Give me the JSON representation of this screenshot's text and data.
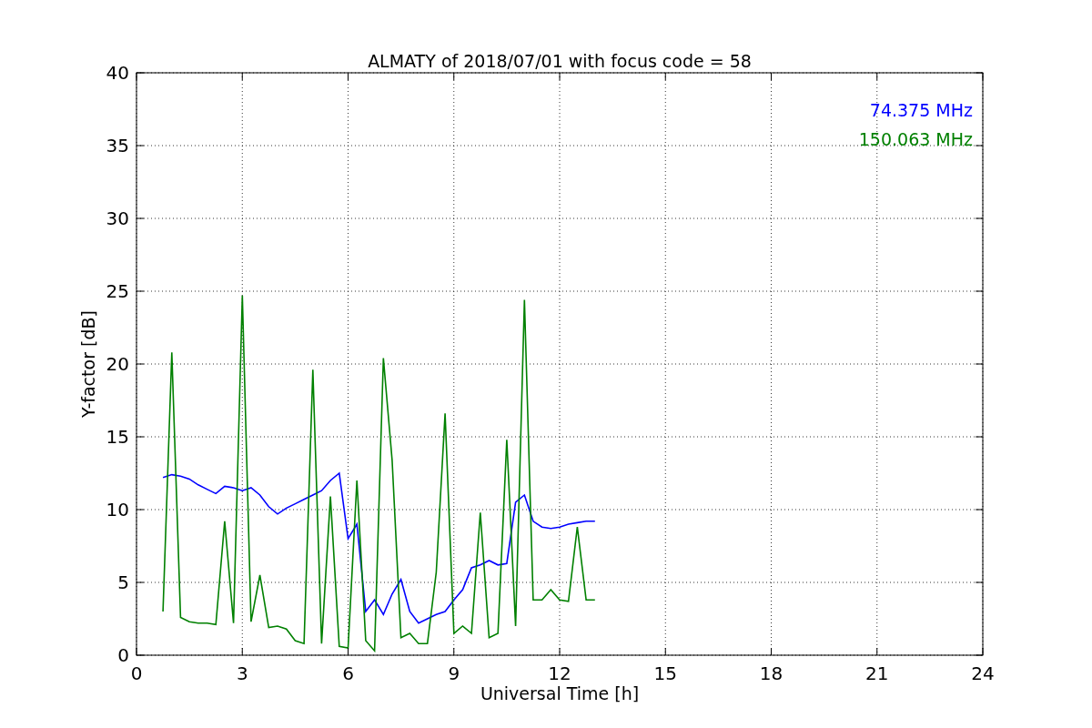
{
  "figure": {
    "chart_data": {
      "type": "line",
      "title": "ALMATY of 2018/07/01 with focus code = 58",
      "xlabel": "Universal Time [h]",
      "ylabel": "Y-factor [dB]",
      "xlim": [
        0,
        24
      ],
      "ylim": [
        0,
        40
      ],
      "xticks": [
        0,
        3,
        6,
        9,
        12,
        15,
        18,
        21,
        24
      ],
      "yticks": [
        0,
        5,
        10,
        15,
        20,
        25,
        30,
        35,
        40
      ],
      "grid": true,
      "x": [
        0.75,
        1,
        1.25,
        1.5,
        1.75,
        2,
        2.25,
        2.5,
        2.75,
        3,
        3.25,
        3.5,
        3.75,
        4,
        4.25,
        4.5,
        4.75,
        5,
        5.25,
        5.5,
        5.75,
        6,
        6.25,
        6.5,
        6.75,
        7,
        7.25,
        7.5,
        7.75,
        8,
        8.25,
        8.5,
        8.75,
        9,
        9.25,
        9.5,
        9.75,
        10,
        10.25,
        10.5,
        10.75,
        11,
        11.25,
        11.5,
        11.75,
        12,
        12.25,
        12.5,
        12.75,
        13
      ],
      "series": [
        {
          "name": "74.375 MHz",
          "color": "#0000ff",
          "values": [
            12.2,
            12.4,
            12.3,
            12.1,
            11.7,
            11.4,
            11.1,
            11.6,
            11.5,
            11.3,
            11.5,
            11.0,
            10.2,
            9.7,
            10.1,
            10.4,
            10.7,
            11.0,
            11.3,
            12.0,
            12.5,
            8.0,
            9.0,
            3.0,
            3.8,
            2.8,
            4.2,
            5.2,
            3.0,
            2.2,
            2.5,
            2.8,
            3.0,
            3.8,
            4.5,
            6.0,
            6.2,
            6.5,
            6.2,
            6.3,
            10.5,
            11.0,
            9.2,
            8.8,
            8.7,
            8.8,
            9.0,
            9.1,
            9.2,
            9.2
          ]
        },
        {
          "name": "150.063 MHz",
          "color": "#008000",
          "values": [
            3.0,
            20.8,
            2.6,
            2.3,
            2.2,
            2.2,
            2.1,
            9.2,
            2.2,
            24.7,
            2.3,
            5.5,
            1.9,
            2.0,
            1.8,
            1.0,
            0.8,
            19.6,
            0.8,
            10.9,
            0.6,
            0.5,
            12.0,
            1.0,
            0.3,
            20.4,
            13.4,
            1.2,
            1.5,
            0.8,
            0.8,
            5.7,
            16.6,
            1.5,
            2.0,
            1.5,
            9.8,
            1.2,
            1.5,
            14.8,
            2.0,
            24.4,
            3.8,
            3.8,
            4.5,
            3.8,
            3.7,
            8.8,
            3.8,
            3.8
          ]
        }
      ]
    }
  }
}
